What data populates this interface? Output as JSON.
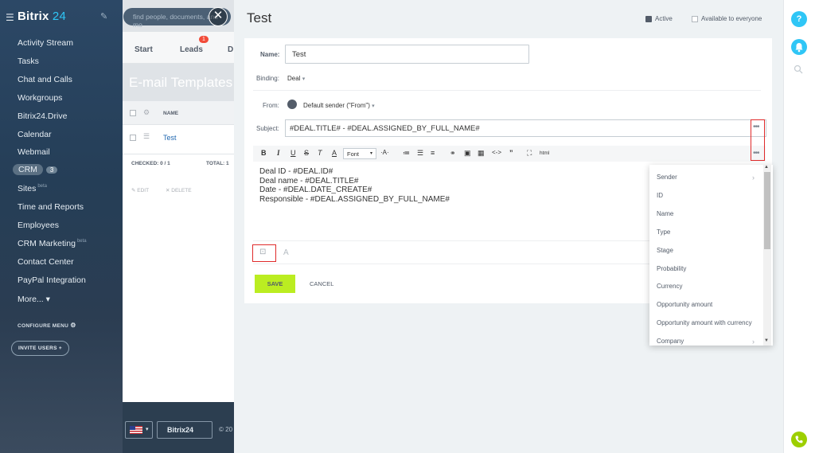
{
  "app": {
    "logo_word": "Bitrix",
    "logo_num": "24"
  },
  "search": {
    "placeholder": "find people, documents, and mo"
  },
  "sidebar": {
    "items": [
      {
        "label": "Activity Stream"
      },
      {
        "label": "Tasks"
      },
      {
        "label": "Chat and Calls"
      },
      {
        "label": "Workgroups"
      },
      {
        "label": "Bitrix24.Drive"
      },
      {
        "label": "Calendar"
      },
      {
        "label": "Webmail"
      },
      {
        "label": "CRM",
        "badge": "3"
      },
      {
        "label": "Sites",
        "beta": "beta"
      },
      {
        "label": "Time and Reports"
      },
      {
        "label": "Employees"
      },
      {
        "label": "CRM Marketing",
        "beta": "beta"
      },
      {
        "label": "Contact Center"
      },
      {
        "label": "PayPal Integration"
      },
      {
        "label": "More...  ▾"
      }
    ],
    "configure_menu": "CONFIGURE MENU",
    "invite_users": "INVITE USERS  +"
  },
  "background": {
    "tabs": [
      "Start",
      "Leads",
      "D"
    ],
    "leads_badge": "1",
    "page_title": "E-mail Templates",
    "col_name": "NAME",
    "row_name": "Test",
    "checked": "CHECKED: 0 / 1",
    "total": "TOTAL: 1",
    "edit": "✎ EDIT",
    "delete": "✕ DELETE",
    "footer_brand": "Bitrix24",
    "copyright": "© 20"
  },
  "panel": {
    "title": "Test",
    "active_label": "Active",
    "everyone_label": "Available to everyone",
    "name_label": "Name:",
    "name_value": "Test",
    "binding_label": "Binding:",
    "binding_value": "Deal",
    "from_label": "From:",
    "from_value": "Default sender (\"From\")",
    "subject_label": "Subject:",
    "subject_value": "#DEAL.TITLE# -  #DEAL.ASSIGNED_BY_FULL_NAME#",
    "font_select": "Font",
    "toolbar_html": "html",
    "body_lines": [
      "Deal ID - #DEAL.ID#",
      "Deal name - #DEAL.TITLE#",
      "Date - #DEAL.DATE_CREATE#",
      "Responsible - #DEAL.ASSIGNED_BY_FULL_NAME#"
    ],
    "save": "SAVE",
    "cancel": "CANCEL"
  },
  "dropdown": {
    "items": [
      {
        "label": "Sender",
        "submenu": true
      },
      {
        "label": "ID"
      },
      {
        "label": "Name"
      },
      {
        "label": "Type"
      },
      {
        "label": "Stage"
      },
      {
        "label": "Probability"
      },
      {
        "label": "Currency"
      },
      {
        "label": "Opportunity amount"
      },
      {
        "label": "Opportunity amount with currency"
      },
      {
        "label": "Company",
        "submenu": true
      }
    ]
  },
  "colors": {
    "accent": "#2fc6f6",
    "save": "#bbed21",
    "highlight": "#e02b2b",
    "phone": "#9dcf00"
  }
}
